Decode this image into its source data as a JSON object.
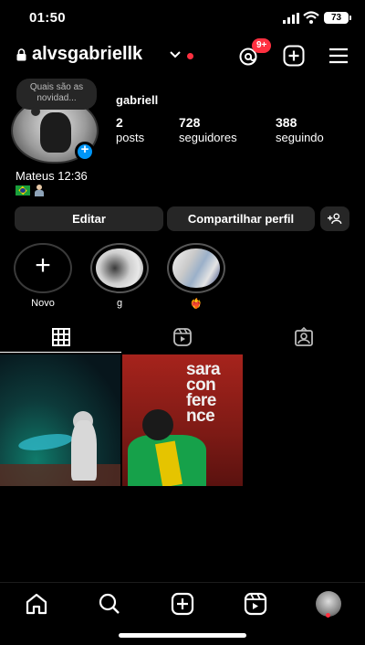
{
  "status_bar": {
    "time": "01:50",
    "battery": "73"
  },
  "header": {
    "username": "alvsgabriellk",
    "notification_count": "9+"
  },
  "profile": {
    "note": "Quais são as novidad...",
    "display_name": "gabriell",
    "stats": [
      {
        "value": "2",
        "label": "posts"
      },
      {
        "value": "728",
        "label": "seguidores"
      },
      {
        "value": "388",
        "label": "seguindo"
      }
    ],
    "bio_line1": "Mateus 12:36"
  },
  "buttons": {
    "edit": "Editar",
    "share": "Compartilhar perfil"
  },
  "highlights": [
    {
      "label": "Novo"
    },
    {
      "label": "g"
    },
    {
      "label": "❤️‍🔥"
    }
  ],
  "tabs": [
    "grid-icon",
    "reels-icon",
    "tagged-icon"
  ],
  "posts": [
    {
      "description": "night pool photo"
    },
    {
      "description": "sara conference",
      "sign_text": "sara conference"
    }
  ],
  "colors": {
    "accent": "#0095f6",
    "badge": "#ff3040",
    "button_bg": "#262626"
  }
}
